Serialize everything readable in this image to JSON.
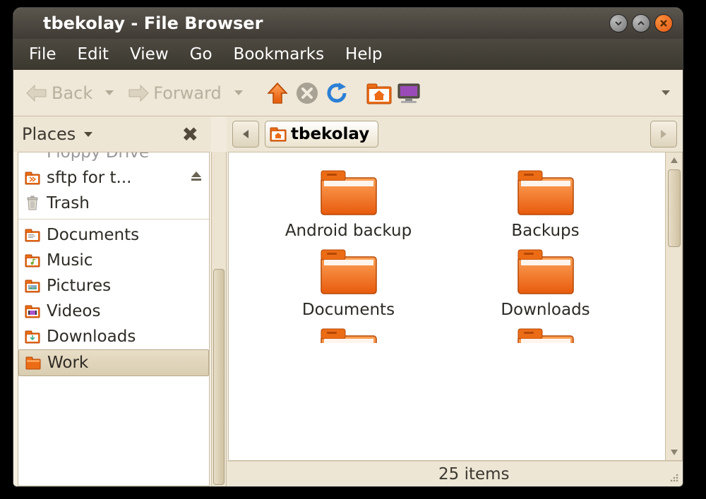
{
  "window": {
    "title": "tbekolay - File Browser"
  },
  "menu": {
    "items": [
      "File",
      "Edit",
      "View",
      "Go",
      "Bookmarks",
      "Help"
    ]
  },
  "toolbar": {
    "back_label": "Back",
    "forward_label": "Forward",
    "icons": {
      "up": "up-arrow-icon",
      "stop": "stop-icon",
      "reload": "reload-icon",
      "home": "home-folder-icon",
      "computer": "computer-icon"
    }
  },
  "sidebar": {
    "header": "Places",
    "items": [
      {
        "label": "Floppy Drive",
        "icon": "floppy-icon",
        "partial": true
      },
      {
        "label": "sftp for t...",
        "icon": "remote-folder-icon",
        "ejectable": true
      },
      {
        "label": "Trash",
        "icon": "trash-icon"
      },
      {
        "label": "Documents",
        "icon": "documents-folder-icon"
      },
      {
        "label": "Music",
        "icon": "music-folder-icon"
      },
      {
        "label": "Pictures",
        "icon": "pictures-folder-icon"
      },
      {
        "label": "Videos",
        "icon": "videos-folder-icon"
      },
      {
        "label": "Downloads",
        "icon": "downloads-folder-icon"
      },
      {
        "label": "Work",
        "icon": "folder-icon",
        "selected": true
      }
    ]
  },
  "pathbar": {
    "current": "tbekolay"
  },
  "content": {
    "folders": [
      {
        "label": "Android backup"
      },
      {
        "label": "Backups"
      },
      {
        "label": "Documents"
      },
      {
        "label": "Downloads"
      }
    ]
  },
  "status": {
    "text": "25 items"
  },
  "colors": {
    "orange": "#e8661a",
    "panel": "#f2ebdd"
  }
}
